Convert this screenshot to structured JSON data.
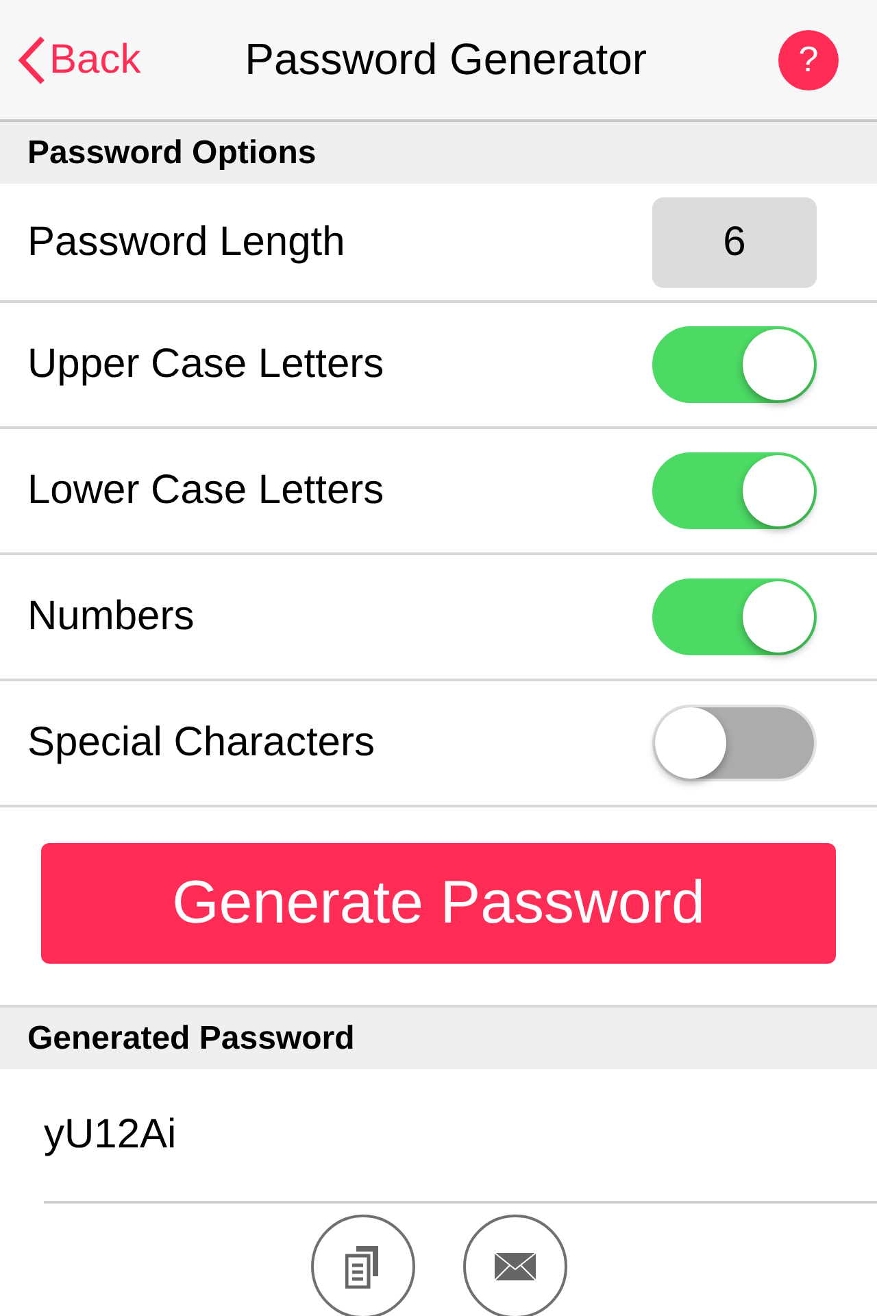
{
  "nav": {
    "back": "Back",
    "title": "Password Generator",
    "help": "?"
  },
  "options_header": "Password Options",
  "options": [
    {
      "kind": "value",
      "label": "Password Length",
      "value": "6"
    },
    {
      "kind": "toggle",
      "label": "Upper Case Letters",
      "on": true
    },
    {
      "kind": "toggle",
      "label": "Lower Case Letters",
      "on": true
    },
    {
      "kind": "toggle",
      "label": "Numbers",
      "on": true
    },
    {
      "kind": "toggle",
      "label": "Special Characters",
      "on": false
    }
  ],
  "generate_button": "Generate Password",
  "result_header": "Generated Password",
  "result": "yU12Ai"
}
